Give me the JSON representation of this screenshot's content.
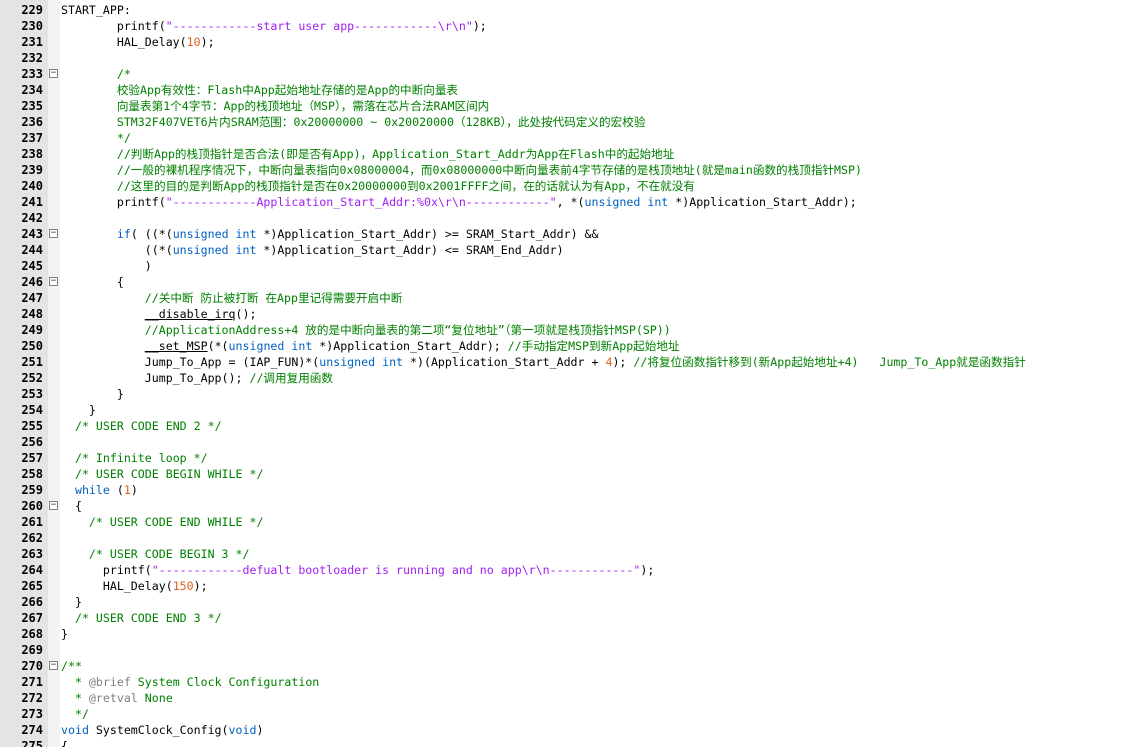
{
  "editor": {
    "colors": {
      "gutter_bg": "#e4e4e4",
      "text": "#000000",
      "string": "#a020f0",
      "number": "#e06020",
      "keyword": "#0060c0",
      "comment": "#008000",
      "doc_tag": "#808080"
    },
    "lines": [
      {
        "n": "229",
        "fold": false,
        "t": [
          [
            "plain",
            "START_APP:"
          ]
        ]
      },
      {
        "n": "230",
        "fold": false,
        "t": [
          [
            "plain",
            "        printf("
          ],
          [
            "str",
            "\"------------start user app------------\\r\\n\""
          ],
          [
            "plain",
            ");"
          ]
        ]
      },
      {
        "n": "231",
        "fold": false,
        "t": [
          [
            "plain",
            "        HAL_Delay("
          ],
          [
            "num",
            "10"
          ],
          [
            "plain",
            ");"
          ]
        ]
      },
      {
        "n": "232",
        "fold": false,
        "t": []
      },
      {
        "n": "233",
        "fold": true,
        "t": [
          [
            "plain",
            "        "
          ],
          [
            "cmt",
            "/*"
          ]
        ]
      },
      {
        "n": "234",
        "fold": false,
        "t": [
          [
            "cmt",
            "        校验App有效性：Flash中App起始地址存储的是App的中断向量表"
          ]
        ]
      },
      {
        "n": "235",
        "fold": false,
        "t": [
          [
            "cmt",
            "        向量表第1个4字节：App的栈顶地址（MSP），需落在芯片合法RAM区间内"
          ]
        ]
      },
      {
        "n": "236",
        "fold": false,
        "t": [
          [
            "cmt",
            "        STM32F407VET6片内SRAM范围：0x20000000 ~ 0x20020000（128KB），此处按代码定义的宏校验"
          ]
        ]
      },
      {
        "n": "237",
        "fold": false,
        "t": [
          [
            "cmt",
            "        */"
          ]
        ]
      },
      {
        "n": "238",
        "fold": false,
        "t": [
          [
            "cmt",
            "        //判断App的栈顶指针是否合法(即是否有App)，Application_Start_Addr为App在Flash中的起始地址"
          ]
        ]
      },
      {
        "n": "239",
        "fold": false,
        "t": [
          [
            "cmt",
            "        //一般的裸机程序情况下，中断向量表指向0x08000004，而0x08000000中断向量表前4字节存储的是栈顶地址(就是main函数的栈顶指针MSP)"
          ]
        ]
      },
      {
        "n": "240",
        "fold": false,
        "t": [
          [
            "cmt",
            "        //这里的目的是判断App的栈顶指针是否在0x20000000到0x2001FFFF之间，在的话就认为有App，不在就没有"
          ]
        ]
      },
      {
        "n": "241",
        "fold": false,
        "t": [
          [
            "plain",
            "        printf("
          ],
          [
            "str",
            "\"------------Application_Start_Addr:%0x\\r\\n------------\""
          ],
          [
            "plain",
            ", *("
          ],
          [
            "kw",
            "unsigned int"
          ],
          [
            "plain",
            " *)Application_Start_Addr);"
          ]
        ]
      },
      {
        "n": "242",
        "fold": false,
        "t": []
      },
      {
        "n": "243",
        "fold": true,
        "t": [
          [
            "plain",
            "        "
          ],
          [
            "kw",
            "if"
          ],
          [
            "plain",
            "( ((*("
          ],
          [
            "kw",
            "unsigned int"
          ],
          [
            "plain",
            " *)Application_Start_Addr) >= SRAM_Start_Addr) &&"
          ]
        ]
      },
      {
        "n": "244",
        "fold": false,
        "t": [
          [
            "plain",
            "            ((*("
          ],
          [
            "kw",
            "unsigned int"
          ],
          [
            "plain",
            " *)Application_Start_Addr) <= SRAM_End_Addr)"
          ]
        ]
      },
      {
        "n": "245",
        "fold": false,
        "t": [
          [
            "plain",
            "            )"
          ]
        ]
      },
      {
        "n": "246",
        "fold": true,
        "t": [
          [
            "plain",
            "        {"
          ]
        ]
      },
      {
        "n": "247",
        "fold": false,
        "t": [
          [
            "plain",
            "            "
          ],
          [
            "cmt",
            "//关中断 防止被打断 在App里记得需要开启中断"
          ]
        ]
      },
      {
        "n": "248",
        "fold": false,
        "t": [
          [
            "plain",
            "            "
          ],
          [
            "u",
            "__disable_irq"
          ],
          [
            "plain",
            "();"
          ]
        ]
      },
      {
        "n": "249",
        "fold": false,
        "t": [
          [
            "plain",
            "            "
          ],
          [
            "cmt",
            "//ApplicationAddress+4 放的是中断向量表的第二项“复位地址”（第一项就是栈顶指针MSP(SP))"
          ]
        ]
      },
      {
        "n": "250",
        "fold": false,
        "t": [
          [
            "plain",
            "            "
          ],
          [
            "u",
            "__set_MSP"
          ],
          [
            "plain",
            "(*("
          ],
          [
            "kw",
            "unsigned int"
          ],
          [
            "plain",
            " *)Application_Start_Addr); "
          ],
          [
            "cmt",
            "//手动指定MSP到新App起始地址"
          ]
        ]
      },
      {
        "n": "251",
        "fold": false,
        "t": [
          [
            "plain",
            "            Jump_To_App = (IAP_FUN)*("
          ],
          [
            "kw",
            "unsigned int"
          ],
          [
            "plain",
            " *)(Application_Start_Addr + "
          ],
          [
            "num",
            "4"
          ],
          [
            "plain",
            "); "
          ],
          [
            "cmt",
            "//将复位函数指针移到(新App起始地址+4)   Jump_To_App就是函数指针"
          ]
        ]
      },
      {
        "n": "252",
        "fold": false,
        "t": [
          [
            "plain",
            "            Jump_To_App(); "
          ],
          [
            "cmt",
            "//调用复用函数"
          ]
        ]
      },
      {
        "n": "253",
        "fold": false,
        "t": [
          [
            "plain",
            "        }"
          ]
        ]
      },
      {
        "n": "254",
        "fold": false,
        "t": [
          [
            "plain",
            "    }"
          ]
        ]
      },
      {
        "n": "255",
        "fold": false,
        "t": [
          [
            "plain",
            "  "
          ],
          [
            "cmt",
            "/* USER CODE END 2 */"
          ]
        ]
      },
      {
        "n": "256",
        "fold": false,
        "t": []
      },
      {
        "n": "257",
        "fold": false,
        "t": [
          [
            "plain",
            "  "
          ],
          [
            "cmt",
            "/* Infinite loop */"
          ]
        ]
      },
      {
        "n": "258",
        "fold": false,
        "t": [
          [
            "plain",
            "  "
          ],
          [
            "cmt",
            "/* USER CODE BEGIN WHILE */"
          ]
        ]
      },
      {
        "n": "259",
        "fold": false,
        "t": [
          [
            "plain",
            "  "
          ],
          [
            "kw",
            "while"
          ],
          [
            "plain",
            " ("
          ],
          [
            "num",
            "1"
          ],
          [
            "plain",
            ")"
          ]
        ]
      },
      {
        "n": "260",
        "fold": true,
        "t": [
          [
            "plain",
            "  {"
          ]
        ]
      },
      {
        "n": "261",
        "fold": false,
        "t": [
          [
            "plain",
            "    "
          ],
          [
            "cmt",
            "/* USER CODE END WHILE */"
          ]
        ]
      },
      {
        "n": "262",
        "fold": false,
        "t": []
      },
      {
        "n": "263",
        "fold": false,
        "t": [
          [
            "plain",
            "    "
          ],
          [
            "cmt",
            "/* USER CODE BEGIN 3 */"
          ]
        ]
      },
      {
        "n": "264",
        "fold": false,
        "t": [
          [
            "plain",
            "      printf("
          ],
          [
            "str",
            "\"------------defualt bootloader is running and no app\\r\\n------------\""
          ],
          [
            "plain",
            ");"
          ]
        ]
      },
      {
        "n": "265",
        "fold": false,
        "t": [
          [
            "plain",
            "      HAL_Delay("
          ],
          [
            "num",
            "150"
          ],
          [
            "plain",
            ");"
          ]
        ]
      },
      {
        "n": "266",
        "fold": false,
        "t": [
          [
            "plain",
            "  }"
          ]
        ]
      },
      {
        "n": "267",
        "fold": false,
        "t": [
          [
            "plain",
            "  "
          ],
          [
            "cmt",
            "/* USER CODE END 3 */"
          ]
        ]
      },
      {
        "n": "268",
        "fold": false,
        "t": [
          [
            "plain",
            "}"
          ]
        ]
      },
      {
        "n": "269",
        "fold": false,
        "t": []
      },
      {
        "n": "270",
        "fold": true,
        "t": [
          [
            "cmt",
            "/**"
          ]
        ]
      },
      {
        "n": "271",
        "fold": false,
        "t": [
          [
            "cmt",
            "  * "
          ],
          [
            "dox",
            "@brief"
          ],
          [
            "cmt",
            " System Clock Configuration"
          ]
        ]
      },
      {
        "n": "272",
        "fold": false,
        "t": [
          [
            "cmt",
            "  * "
          ],
          [
            "dox",
            "@retval"
          ],
          [
            "cmt",
            " None"
          ]
        ]
      },
      {
        "n": "273",
        "fold": false,
        "t": [
          [
            "cmt",
            "  */"
          ]
        ]
      },
      {
        "n": "274",
        "fold": false,
        "t": [
          [
            "kw",
            "void"
          ],
          [
            "plain",
            " SystemClock_Config("
          ],
          [
            "kw",
            "void"
          ],
          [
            "plain",
            ")"
          ]
        ]
      },
      {
        "n": "275",
        "fold": false,
        "t": [
          [
            "plain",
            "{"
          ]
        ]
      }
    ]
  }
}
